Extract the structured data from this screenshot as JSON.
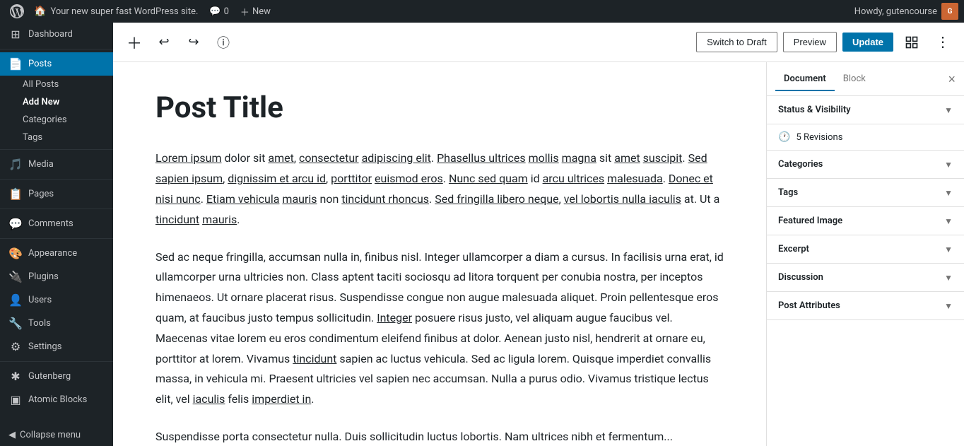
{
  "admin_bar": {
    "wp_logo": "W",
    "site_name": "Your new super fast WordPress site.",
    "comments_count": "0",
    "new_label": "New",
    "howdy_text": "Howdy, gutencourse",
    "avatar_initials": "G"
  },
  "sidebar": {
    "dashboard_label": "Dashboard",
    "posts_label": "Posts",
    "posts_active": true,
    "all_posts_label": "All Posts",
    "add_new_label": "Add New",
    "categories_label": "Categories",
    "tags_label": "Tags",
    "media_label": "Media",
    "pages_label": "Pages",
    "comments_label": "Comments",
    "appearance_label": "Appearance",
    "plugins_label": "Plugins",
    "users_label": "Users",
    "tools_label": "Tools",
    "settings_label": "Settings",
    "gutenberg_label": "Gutenberg",
    "atomic_blocks_label": "Atomic Blocks",
    "collapse_menu_label": "Collapse menu"
  },
  "toolbar": {
    "switch_to_draft_label": "Switch to Draft",
    "preview_label": "Preview",
    "update_label": "Update"
  },
  "editor": {
    "post_title": "Post Title",
    "paragraphs": [
      "Lorem ipsum dolor sit amet, consectetur adipiscing elit. Phasellus ultrices mollis magna sit amet suscipit. Sed sapien ipsum, dignissim et arcu id, porttitor euismod eros. Nunc sed quam id arcu ultrices malesuada. Donec et nisi nunc. Etiam vehicula mauris non tincidunt rhoncus. Sed fringilla libero neque, vel lobortis nulla iaculis at. Ut a tincidunt mauris.",
      "Sed ac neque fringilla, accumsan nulla in, finibus nisl. Integer ullamcorper a diam a cursus. In facilisis urna erat, id ullamcorper urna ultricies non. Class aptent taciti sociosqu ad litora torquent per conubia nostra, per inceptos himenaeos. Ut ornare placerat risus. Suspendisse congue non augue malesuada aliquet. Proin pellentesque eros quam, at faucibus justo tempus sollicitudin. Integer posuere risus justo, vel aliquam augue faucibus vel. Maecenas vitae lorem eu eros condimentum eleifend finibus at dolor. Aenean justo nisl, hendrerit at ornare eu, porttitor at lorem. Vivamus tincidunt sapien ac luctus vehicula. Sed ac ligula lorem. Quisque imperdiet convallis massa, in vehicula mi. Praesent ultricies vel sapien nec accumsan. Nulla a purus odio. Vivamus tristique lectus elit, vel iaculis felis imperdiet in.",
      "Suspendisse porta consectetur nulla. Duis sollicitudin luctus lobortis. Nam ultrices nibh et fermentum..."
    ]
  },
  "right_panel": {
    "document_tab": "Document",
    "block_tab": "Block",
    "sections": [
      {
        "title": "Status & Visibility",
        "has_chevron": true
      },
      {
        "title": "Categories",
        "has_chevron": true
      },
      {
        "title": "Tags",
        "has_chevron": true
      },
      {
        "title": "Featured Image",
        "has_chevron": true
      },
      {
        "title": "Excerpt",
        "has_chevron": true
      },
      {
        "title": "Discussion",
        "has_chevron": true
      },
      {
        "title": "Post Attributes",
        "has_chevron": true
      }
    ],
    "revisions_count": "5 Revisions"
  }
}
